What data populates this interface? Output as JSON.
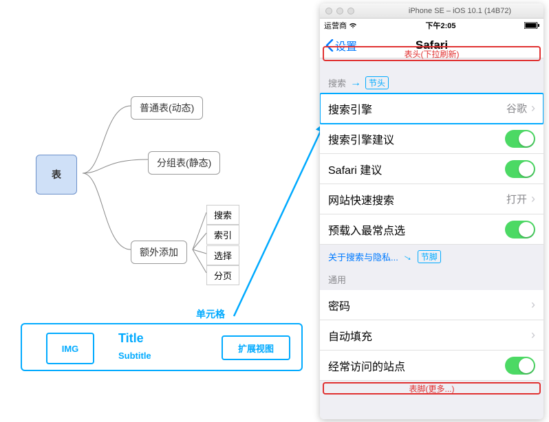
{
  "mindmap": {
    "root": "表",
    "nodes": {
      "dynamic": "普通表(动态)",
      "grouped": "分组表(静态)",
      "extra": "额外添加"
    },
    "leaves": [
      "搜索",
      "索引",
      "选择",
      "分页"
    ],
    "cell_label": "单元格",
    "cell": {
      "img": "IMG",
      "title": "Title",
      "subtitle": "Subtitle",
      "accessory": "扩展视图"
    }
  },
  "sim": {
    "window_title": "iPhone SE – iOS 10.1 (14B72)",
    "status": {
      "carrier": "运营商",
      "time": "下午2:05"
    },
    "nav": {
      "back": "设置",
      "title": "Safari"
    },
    "header_callout": "表头(下拉刷新)",
    "footer_callout": "表脚(更多...)",
    "section1": {
      "header": "搜索",
      "header_tag": "节头",
      "rows": [
        {
          "label": "搜索引擎",
          "value": "谷歌",
          "type": "disclosure"
        },
        {
          "label": "搜索引擎建议",
          "type": "switch"
        },
        {
          "label": "Safari 建议",
          "type": "switch"
        },
        {
          "label": "网站快速搜索",
          "value": "打开",
          "type": "disclosure"
        },
        {
          "label": "预载入最常点选",
          "type": "switch"
        }
      ],
      "footer": "关于搜索与隐私...",
      "footer_tag": "节脚"
    },
    "section2": {
      "header": "通用",
      "rows": [
        {
          "label": "密码",
          "type": "disclosure"
        },
        {
          "label": "自动填充",
          "type": "disclosure"
        },
        {
          "label": "经常访问的站点",
          "type": "switch"
        }
      ]
    }
  }
}
